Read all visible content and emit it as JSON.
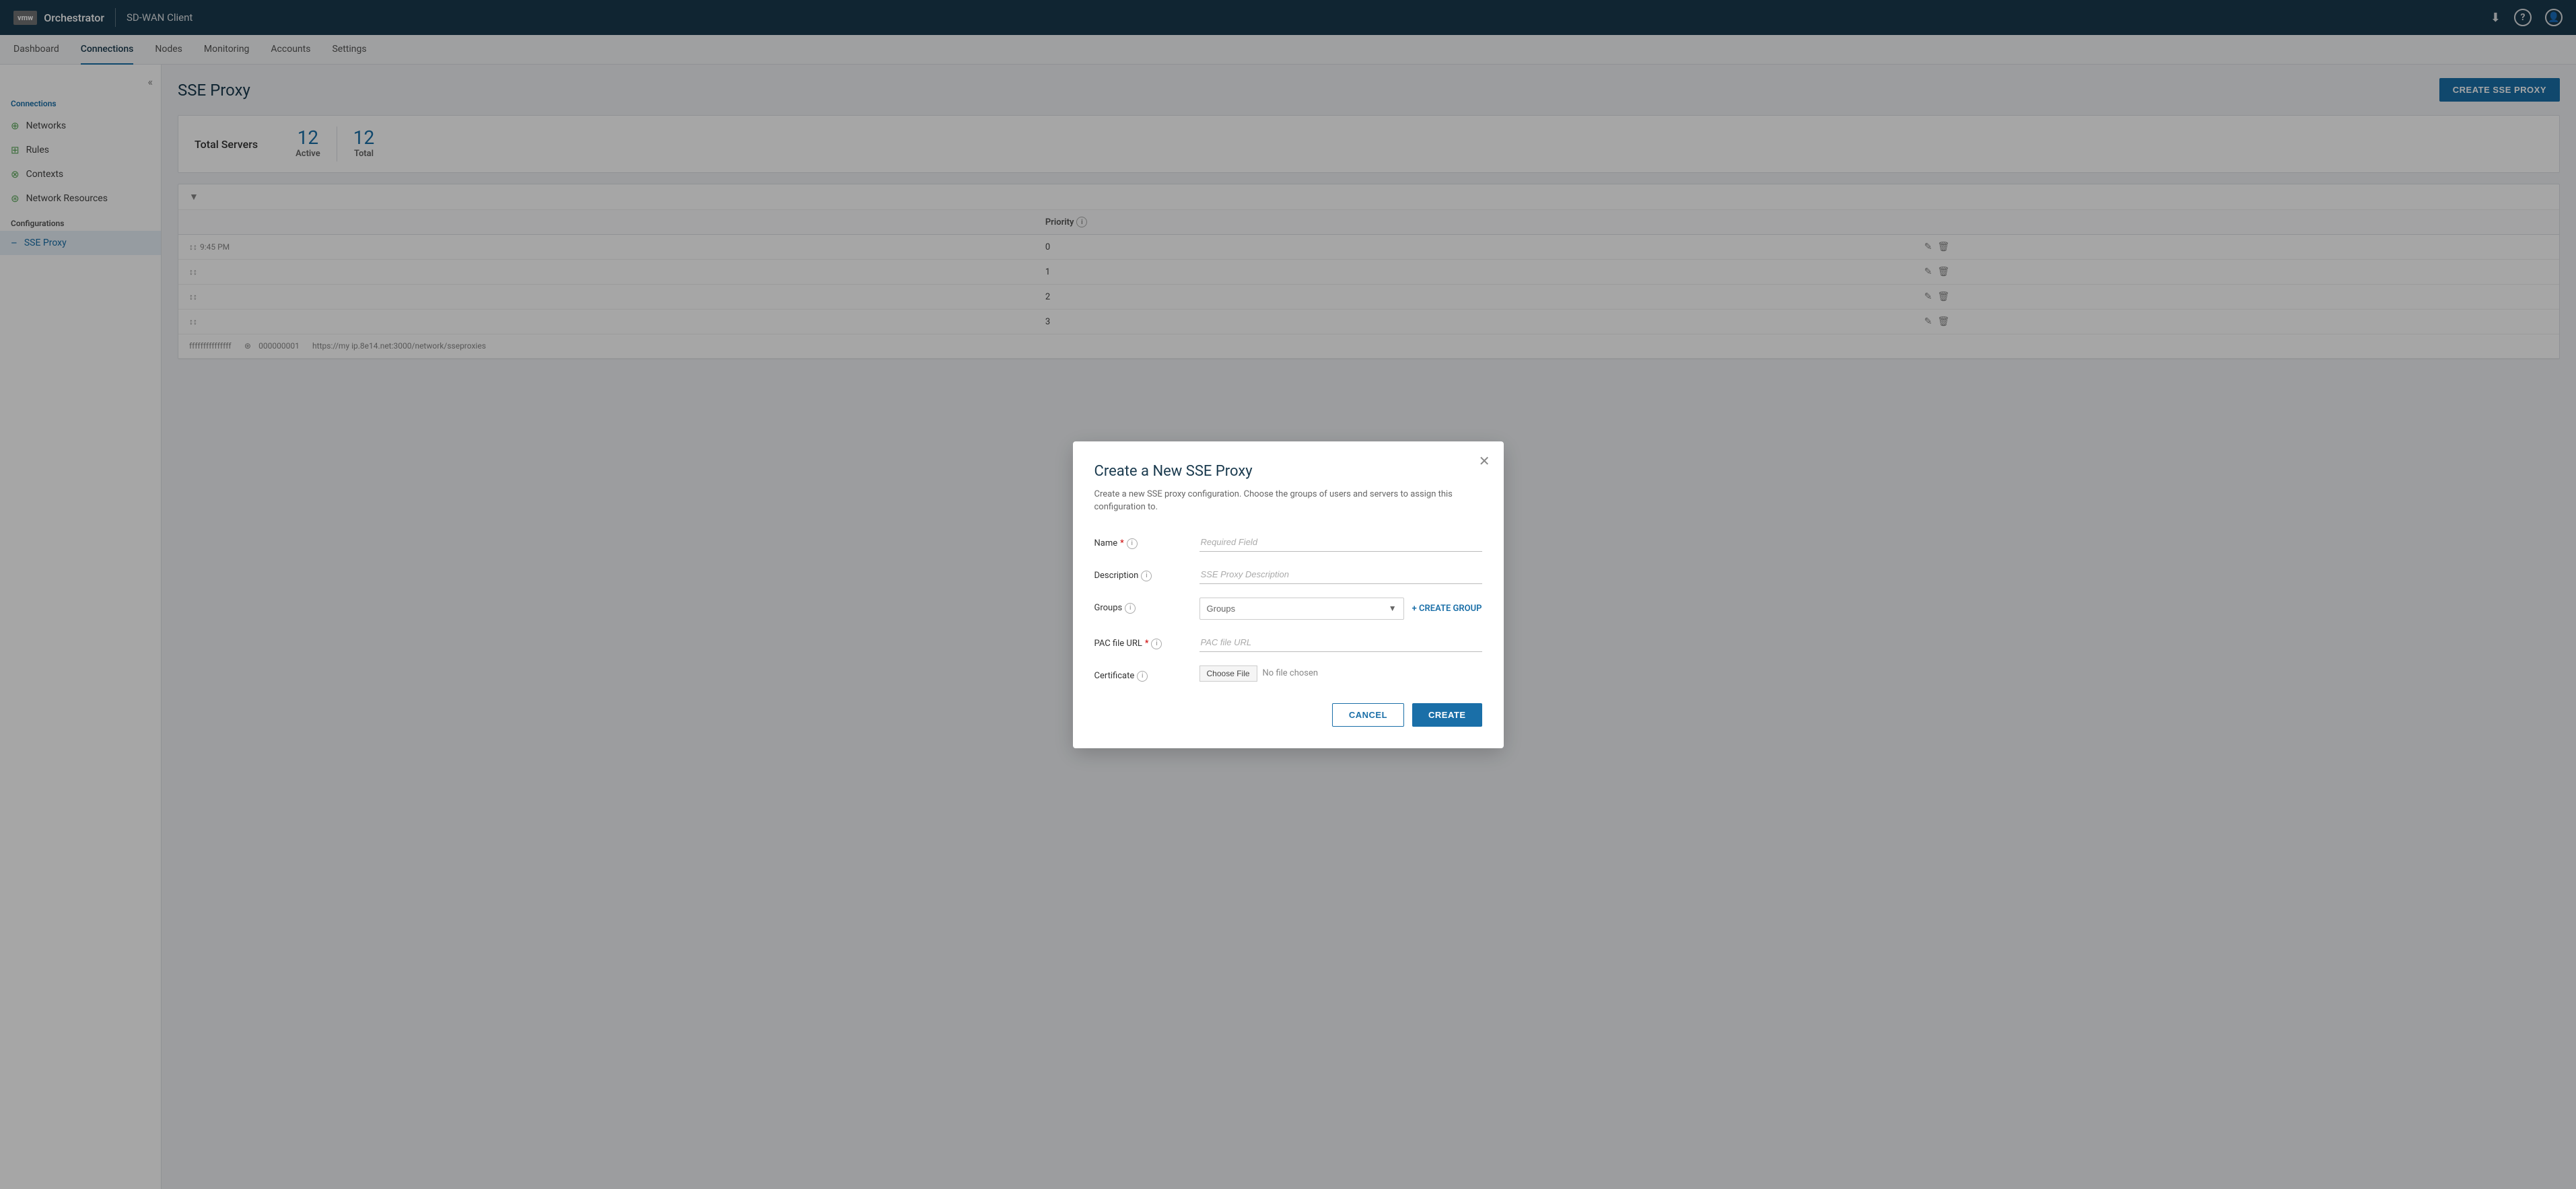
{
  "topbar": {
    "logo_text": "vmw",
    "app_name": "Orchestrator",
    "product_name": "SD-WAN Client",
    "download_icon": "⬇",
    "help_icon": "?",
    "user_icon": "👤"
  },
  "secnav": {
    "items": [
      {
        "label": "Dashboard",
        "active": false
      },
      {
        "label": "Connections",
        "active": true
      },
      {
        "label": "Nodes",
        "active": false
      },
      {
        "label": "Monitoring",
        "active": false
      },
      {
        "label": "Accounts",
        "active": false
      },
      {
        "label": "Settings",
        "active": false
      }
    ],
    "collapse_icon": "«"
  },
  "sidebar": {
    "connections_label": "Connections",
    "items": [
      {
        "label": "Networks",
        "icon": "⊕",
        "active": false
      },
      {
        "label": "Rules",
        "icon": "⊞",
        "active": false
      },
      {
        "label": "Contexts",
        "icon": "⊗",
        "active": false
      },
      {
        "label": "Network Resources",
        "icon": "⊛",
        "active": false
      }
    ],
    "configurations_label": "Configurations",
    "config_items": [
      {
        "label": "SSE Proxy",
        "active": true
      }
    ]
  },
  "page": {
    "title": "SSE Proxy",
    "create_btn": "CREATE SSE PROXY"
  },
  "stats": {
    "title": "Total Servers",
    "active_label": "Active",
    "active_value": "12",
    "total_label": "Total",
    "total_value": "12"
  },
  "table": {
    "columns": [
      "",
      "Priority",
      ""
    ],
    "rows": [
      {
        "time": "9:45 PM",
        "priority": "0",
        "edit": "✎",
        "delete": "🗑"
      },
      {
        "time": "",
        "priority": "1",
        "edit": "✎",
        "delete": "🗑"
      },
      {
        "time": "",
        "priority": "2",
        "edit": "✎",
        "delete": "🗑"
      },
      {
        "time": "",
        "priority": "3",
        "edit": "✎",
        "delete": "🗑"
      }
    ],
    "footer_text": "fffffffffffffff",
    "footer_id": "000000001",
    "footer_url": "https://my ip.8e14.net:3000/network/sseproxies"
  },
  "modal": {
    "title": "Create a New SSE Proxy",
    "description": "Create a new SSE proxy configuration. Choose the groups of users and servers to assign this configuration to.",
    "close_icon": "✕",
    "fields": {
      "name": {
        "label": "Name",
        "required": true,
        "placeholder": "Required Field",
        "info": "i"
      },
      "description": {
        "label": "Description",
        "required": false,
        "placeholder": "SSE Proxy Description",
        "info": "i"
      },
      "groups": {
        "label": "Groups",
        "required": false,
        "placeholder": "Groups",
        "info": "i",
        "create_group_label": "+ CREATE GROUP"
      },
      "pac_file_url": {
        "label": "PAC file URL",
        "required": true,
        "placeholder": "PAC file URL",
        "info": "i"
      },
      "certificate": {
        "label": "Certificate",
        "required": false,
        "info": "i",
        "choose_file_label": "Choose File",
        "no_file_text": "No file chosen"
      }
    },
    "buttons": {
      "cancel": "CANCEL",
      "create": "CREATE"
    }
  }
}
